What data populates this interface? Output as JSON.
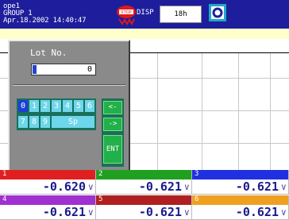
{
  "status": {
    "user": "ope1",
    "group": "GROUP 1",
    "datetime": "Apr.18.2002 14:40:47",
    "disp_label": "DISP",
    "trend_rate": "18h"
  },
  "icons": {
    "alarm": "alarm-stop-icon",
    "memory": "memory-status-icon"
  },
  "dialog": {
    "title": "Lot No.",
    "value": "0",
    "keys_row1": [
      "0",
      "1",
      "2",
      "3",
      "4",
      "5",
      "6"
    ],
    "keys_row2": [
      "7",
      "8",
      "9",
      "Sp"
    ],
    "nav": {
      "back": "<-",
      "forward": "->",
      "enter": "ENT"
    },
    "selected_key": "0"
  },
  "channels": [
    {
      "num": "1",
      "value": "-0.620",
      "unit": "V",
      "color": "#e02020"
    },
    {
      "num": "2",
      "value": "-0.621",
      "unit": "V",
      "color": "#20a020"
    },
    {
      "num": "3",
      "value": "-0.621",
      "unit": "V",
      "color": "#2030e0"
    },
    {
      "num": "4",
      "value": "-0.621",
      "unit": "V",
      "color": "#a030d0"
    },
    {
      "num": "5",
      "value": "-0.621",
      "unit": "V",
      "color": "#b02020"
    },
    {
      "num": "6",
      "value": "-0.621",
      "unit": "V",
      "color": "#f0a020"
    }
  ]
}
